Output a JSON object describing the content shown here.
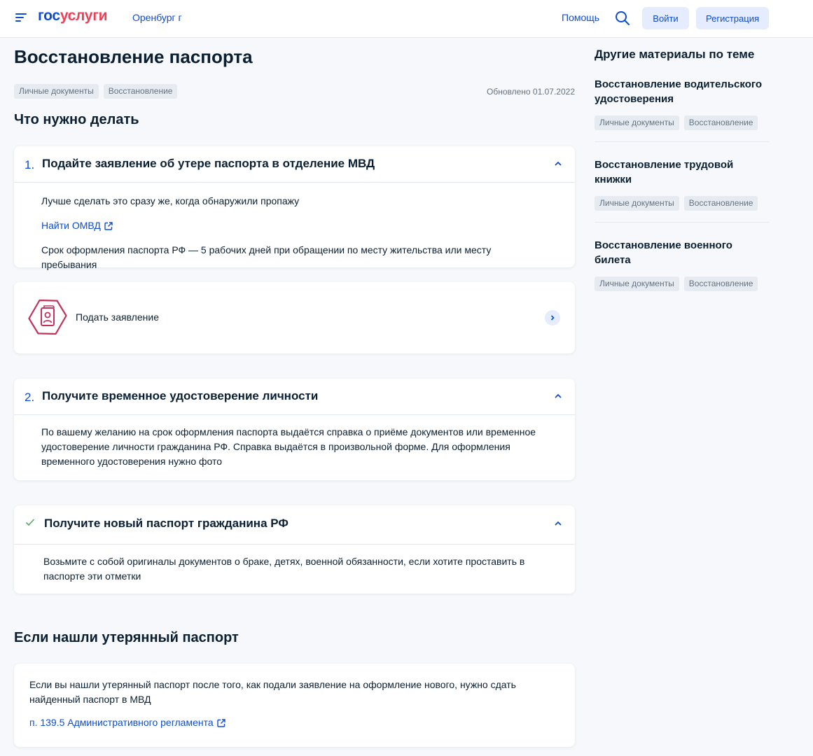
{
  "header": {
    "logo_part1": "гос",
    "logo_part2": "услуги",
    "region": "Оренбург г",
    "help": "Помощь",
    "login": "Войти",
    "register": "Регистрация"
  },
  "colors": {
    "brand": "#0d4cd3",
    "logo_accent": "#ee3f58",
    "icon_accent": "#c2335a",
    "success": "#5ba568",
    "page_bg": "#f6f8fb"
  },
  "main": {
    "title": "Восстановление паспорта",
    "tags": [
      "Личные документы",
      "Восстановление"
    ],
    "updated": "Обновлено 01.07.2022",
    "what_to_do": "Что нужно делать",
    "steps": [
      {
        "num": "1.",
        "title": "Подайте заявление об утере паспорта в отделение МВД",
        "text1": "Лучше сделать это сразу же, когда обнаружили пропажу",
        "link": "Найти ОМВД",
        "text2": "Срок оформления паспорта РФ — 5 рабочих дней при обращении по месту жительства или месту пребывания"
      },
      {
        "num": "2.",
        "title": "Получите временное удостоверение личности",
        "text1": "По вашему желанию на срок оформления паспорта выдаётся справка о приёме документов или временное удостоверение личности гражданина РФ. Справка выдаётся в произвольной форме. Для оформления временного удостоверения нужно фото"
      },
      {
        "title": "Получите новый паспорт гражданина РФ",
        "text1": "Возьмите с собой оригиналы документов о браке, детях, военной обязанности, если хотите проставить в паспорте эти отметки"
      }
    ],
    "service": {
      "label": "Подать заявление",
      "icon": "passport-icon"
    },
    "found": {
      "title": "Если нашли утерянный паспорт",
      "text": "Если вы нашли утерянный паспорт после того, как подали заявление на оформление нового, нужно сдать найденный паспорт в МВД",
      "link": "п. 139.5 Административного регламента"
    }
  },
  "aside": {
    "title": "Другие материалы по теме",
    "items": [
      {
        "title": "Восстановление водительского удостоверения",
        "tags": [
          "Личные документы",
          "Восстановление"
        ]
      },
      {
        "title": "Восстановление трудовой книжки",
        "tags": [
          "Личные документы",
          "Восстановление"
        ]
      },
      {
        "title": "Восстановление военного билета",
        "tags": [
          "Личные документы",
          "Восстановление"
        ]
      }
    ]
  }
}
